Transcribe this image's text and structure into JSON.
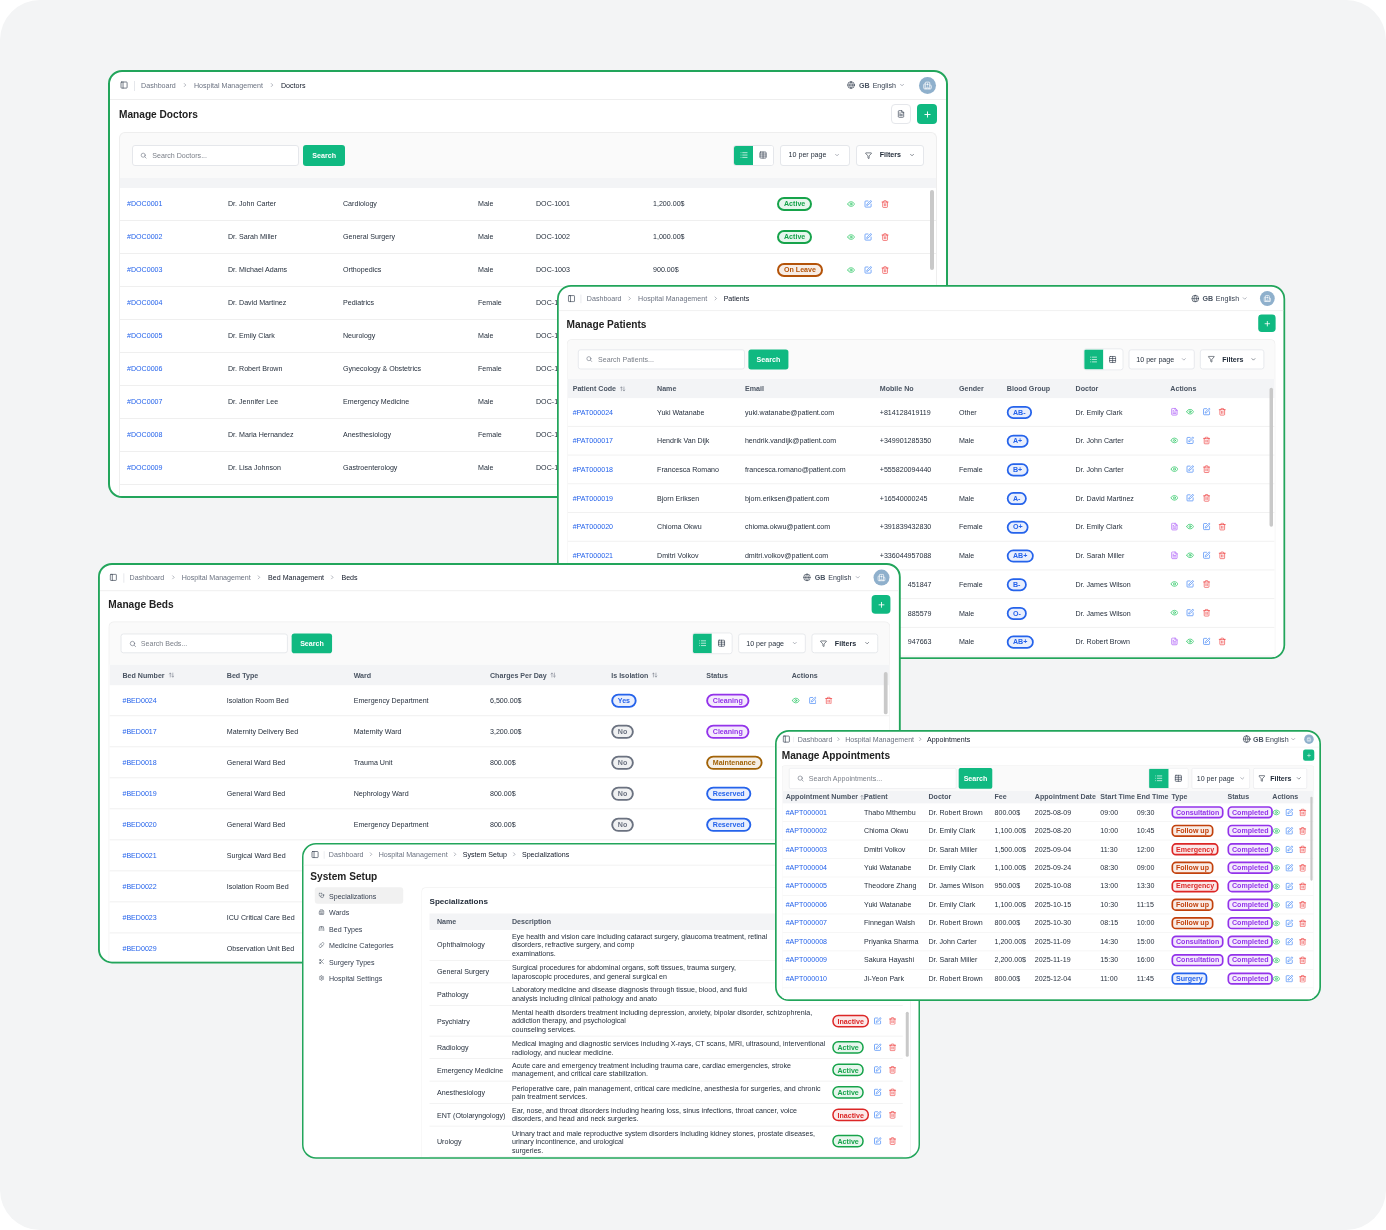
{
  "windows": [
    {
      "kind": "table",
      "breadcrumb": [
        {
          "label": "Dashboard",
          "muted": true
        },
        {
          "label": "Hospital Management",
          "muted": true
        },
        {
          "label": "Doctors",
          "muted": false
        }
      ],
      "language": {
        "code": "GB",
        "label": "English"
      },
      "title": "Manage Doctors",
      "export_button": true,
      "add_button": true,
      "search": {
        "placeholder": "Search Doctors...",
        "button": "Search"
      },
      "view_toggle": [
        {
          "selected": true
        },
        {
          "selected": false
        }
      ],
      "per_page": "10 per page",
      "filters": "Filters",
      "rows": [
        [
          {
            "link": "#DOC0001"
          },
          "Dr. John Carter",
          "Cardiology",
          "Male",
          "DOC-1001",
          "1,200.00$",
          {
            "badge": "Active",
            "color": "#16a34a"
          },
          {
            "actions": [
              {
                "kind": "view"
              },
              {
                "kind": "edit"
              },
              {
                "kind": "delete"
              }
            ]
          }
        ],
        [
          {
            "link": "#DOC0002"
          },
          "Dr. Sarah Miller",
          "General Surgery",
          "Male",
          "DOC-1002",
          "1,000.00$",
          {
            "badge": "Active",
            "color": "#16a34a"
          },
          {
            "actions": [
              {
                "kind": "view"
              },
              {
                "kind": "edit"
              },
              {
                "kind": "delete"
              }
            ]
          }
        ],
        [
          {
            "link": "#DOC0003"
          },
          "Dr. Michael Adams",
          "Orthopedics",
          "Male",
          "DOC-1003",
          "900.00$",
          {
            "badge": "On Leave",
            "color": "#b45309"
          },
          {
            "actions": [
              {
                "kind": "view"
              },
              {
                "kind": "edit"
              },
              {
                "kind": "delete"
              }
            ]
          }
        ],
        [
          {
            "link": "#DOC0004"
          },
          "Dr. David Martinez",
          "Pediatrics",
          "Female",
          "DOC-1"
        ],
        [
          {
            "link": "#DOC0005"
          },
          "Dr. Emily Clark",
          "Neurology",
          "Male",
          "DOC-1"
        ],
        [
          {
            "link": "#DOC0006"
          },
          "Dr. Robert Brown",
          "Gynecology & Obstetrics",
          "Female",
          "DOC-1"
        ],
        [
          {
            "link": "#DOC0007"
          },
          "Dr. Jennifer Lee",
          "Emergency Medicine",
          "Male",
          "DOC-1"
        ],
        [
          {
            "link": "#DOC0008"
          },
          "Dr. Maria Hernandez",
          "Anesthesiology",
          "Female",
          "DOC-1"
        ],
        [
          {
            "link": "#DOC0009"
          },
          "Dr. Lisa Johnson",
          "Gastroenterology",
          "Male",
          "DOC-1"
        ]
      ]
    },
    {
      "kind": "table",
      "breadcrumb": [
        {
          "label": "Dashboard",
          "muted": true
        },
        {
          "label": "Hospital Management",
          "muted": true
        },
        {
          "label": "Patients",
          "muted": false
        }
      ],
      "language": {
        "code": "GB",
        "label": "English"
      },
      "title": "Manage Patients",
      "add_button": true,
      "search": {
        "placeholder": "Search Patients...",
        "button": "Search"
      },
      "view_toggle": [
        {
          "selected": true
        },
        {
          "selected": false
        }
      ],
      "per_page": "10 per page",
      "filters": "Filters",
      "columns": [
        {
          "label": "Patient Code",
          "sortable": true
        },
        {
          "label": "Name",
          "sortable": false
        },
        {
          "label": "Email",
          "sortable": false
        },
        {
          "label": "Mobile No",
          "sortable": false
        },
        {
          "label": "Gender",
          "sortable": false
        },
        {
          "label": "Blood Group",
          "sortable": false
        },
        {
          "label": "Doctor",
          "sortable": false
        },
        {
          "label": "Actions",
          "sortable": false
        }
      ],
      "rows": [
        [
          {
            "link": "#PAT000024"
          },
          "Yuki Watanabe",
          "yuki.watanabe@patient.com",
          "+814128419119",
          "Other",
          {
            "badge": "AB-",
            "color": "#2563eb"
          },
          "Dr. Emily Clark",
          {
            "actions": [
              {
                "kind": "report"
              },
              {
                "kind": "view"
              },
              {
                "kind": "edit"
              },
              {
                "kind": "delete"
              }
            ]
          }
        ],
        [
          {
            "link": "#PAT000017"
          },
          "Hendrik Van Dijk",
          "hendrik.vandijk@patient.com",
          "+349901285350",
          "Male",
          {
            "badge": "A+",
            "color": "#2563eb"
          },
          "Dr. John Carter",
          {
            "actions": [
              {
                "kind": "view"
              },
              {
                "kind": "edit"
              },
              {
                "kind": "delete"
              }
            ]
          }
        ],
        [
          {
            "link": "#PAT000018"
          },
          "Francesca Romano",
          "francesca.romano@patient.com",
          "+555820094440",
          "Female",
          {
            "badge": "B+",
            "color": "#2563eb"
          },
          "Dr. John Carter",
          {
            "actions": [
              {
                "kind": "view"
              },
              {
                "kind": "edit"
              },
              {
                "kind": "delete"
              }
            ]
          }
        ],
        [
          {
            "link": "#PAT000019"
          },
          "Bjorn Eriksen",
          "bjorn.eriksen@patient.com",
          "+16540000245",
          "Male",
          {
            "badge": "A-",
            "color": "#2563eb"
          },
          "Dr. David Martinez",
          {
            "actions": [
              {
                "kind": "view"
              },
              {
                "kind": "edit"
              },
              {
                "kind": "delete"
              }
            ]
          }
        ],
        [
          {
            "link": "#PAT000020"
          },
          "Chioma Okwu",
          "chioma.okwu@patient.com",
          "+391839432830",
          "Female",
          {
            "badge": "O+",
            "color": "#2563eb"
          },
          "Dr. Emily Clark",
          {
            "actions": [
              {
                "kind": "report"
              },
              {
                "kind": "view"
              },
              {
                "kind": "edit"
              },
              {
                "kind": "delete"
              }
            ]
          }
        ],
        [
          {
            "link": "#PAT000021"
          },
          "Dmitri Volkov",
          "dmitri.volkov@patient.com",
          "+336044957088",
          "Male",
          {
            "badge": "AB+",
            "color": "#2563eb"
          },
          "Dr. Sarah Miller",
          {
            "actions": [
              {
                "kind": "report"
              },
              {
                "kind": "view"
              },
              {
                "kind": "edit"
              },
              {
                "kind": "delete"
              }
            ]
          }
        ],
        [
          null,
          null,
          null,
          {
            "text": "451847",
            "cut": true
          },
          "Female",
          {
            "badge": "B-",
            "color": "#2563eb"
          },
          "Dr. James Wilson",
          {
            "actions": [
              {
                "kind": "view"
              },
              {
                "kind": "edit"
              },
              {
                "kind": "delete"
              }
            ]
          }
        ],
        [
          null,
          null,
          null,
          {
            "text": "885579",
            "cut": true
          },
          "Male",
          {
            "badge": "O-",
            "color": "#2563eb"
          },
          "Dr. James Wilson",
          {
            "actions": [
              {
                "kind": "view"
              },
              {
                "kind": "edit"
              },
              {
                "kind": "delete"
              }
            ]
          }
        ],
        [
          null,
          null,
          null,
          {
            "text": "947663",
            "cut": true
          },
          "Male",
          {
            "badge": "AB+",
            "color": "#2563eb"
          },
          "Dr. Robert Brown",
          {
            "actions": [
              {
                "kind": "report"
              },
              {
                "kind": "view"
              },
              {
                "kind": "edit"
              },
              {
                "kind": "delete"
              }
            ]
          }
        ]
      ]
    },
    {
      "kind": "table",
      "breadcrumb": [
        {
          "label": "Dashboard",
          "muted": true
        },
        {
          "label": "Hospital Management",
          "muted": true
        },
        {
          "label": "Bed Management",
          "muted": false
        },
        {
          "label": "Beds",
          "muted": false
        }
      ],
      "language": {
        "code": "GB",
        "label": "English"
      },
      "title": "Manage Beds",
      "add_button": true,
      "search": {
        "placeholder": "Search Beds...",
        "button": "Search"
      },
      "view_toggle": [
        {
          "selected": true
        },
        {
          "selected": false
        }
      ],
      "per_page": "10 per page",
      "filters": "Filters",
      "columns": [
        {
          "label": "Bed Number",
          "sortable": true
        },
        {
          "label": "Bed Type",
          "sortable": false
        },
        {
          "label": "Ward",
          "sortable": false
        },
        {
          "label": "Charges Per Day",
          "sortable": true
        },
        {
          "label": "Is Isolation",
          "sortable": true
        },
        {
          "label": "Status",
          "sortable": false
        },
        {
          "label": "Actions",
          "sortable": false
        }
      ],
      "rows": [
        [
          {
            "link": "#BED0024"
          },
          "Isolation Room Bed",
          "Emergency Department",
          "6,500.00$",
          {
            "badge": "Yes",
            "color": "#2563eb"
          },
          {
            "badge": "Cleaning",
            "color": "#9333ea"
          },
          {
            "actions": [
              {
                "kind": "view"
              },
              {
                "kind": "edit"
              },
              {
                "kind": "delete"
              }
            ]
          }
        ],
        [
          {
            "link": "#BED0017"
          },
          "Maternity Delivery Bed",
          "Maternity Ward",
          "3,200.00$",
          {
            "badge": "No",
            "color": "#6b7280"
          },
          {
            "badge": "Cleaning",
            "color": "#9333ea"
          }
        ],
        [
          {
            "link": "#BED0018"
          },
          "General Ward Bed",
          "Trauma Unit",
          "800.00$",
          {
            "badge": "No",
            "color": "#6b7280"
          },
          {
            "badge": "Maintenance",
            "color": "#a16207"
          }
        ],
        [
          {
            "link": "#BED0019"
          },
          "General Ward Bed",
          "Nephrology Ward",
          "800.00$",
          {
            "badge": "No",
            "color": "#6b7280"
          },
          {
            "badge": "Reserved",
            "color": "#2563eb"
          }
        ],
        [
          {
            "link": "#BED0020"
          },
          "General Ward Bed",
          "Emergency Department",
          "800.00$",
          {
            "badge": "No",
            "color": "#6b7280"
          },
          {
            "badge": "Reserved",
            "color": "#2563eb"
          }
        ],
        [
          {
            "link": "#BED0021"
          },
          "Surgical Ward Bed"
        ],
        [
          {
            "link": "#BED0022"
          },
          "Isolation Room Bed"
        ],
        [
          {
            "link": "#BED0023"
          },
          "ICU Critical Care Bed"
        ],
        [
          {
            "link": "#BED0029"
          },
          "Observation Unit Bed"
        ]
      ]
    },
    {
      "kind": "setup",
      "breadcrumb": [
        {
          "label": "Dashboard",
          "muted": true
        },
        {
          "label": "Hospital Management",
          "muted": true
        },
        {
          "label": "System Setup",
          "muted": false
        },
        {
          "label": "Specializations",
          "muted": false
        }
      ],
      "title": "System Setup",
      "sidebar": [
        {
          "label": "Specializations",
          "kind": "specialty",
          "selected": true
        },
        {
          "label": "Wards",
          "kind": "wards",
          "selected": false
        },
        {
          "label": "Bed Types",
          "kind": "bed",
          "selected": false
        },
        {
          "label": "Medicine Categories",
          "kind": "medicine",
          "selected": false
        },
        {
          "label": "Surgery Types",
          "kind": "surgery",
          "selected": false
        },
        {
          "label": "Hospital Settings",
          "kind": "settings",
          "selected": false
        }
      ],
      "section_title": "Specializations",
      "columns": [
        {
          "label": "Name"
        },
        {
          "label": "Description"
        }
      ],
      "rows": [
        {
          "name": "Ophthalmology",
          "description": [
            "Eye health and vision care including cataract surgery, glaucoma treatment, retinal disorders, refractive surgery, and comp",
            "examinations."
          ]
        },
        {
          "name": "General Surgery",
          "description": [
            "Surgical procedures for abdominal organs, soft tissues, trauma surgery, laparoscopic procedures, and general surgical en"
          ]
        },
        {
          "name": "Pathology",
          "description": [
            "Laboratory medicine and disease diagnosis through tissue, blood, and fluid analysis including clinical pathology and anato"
          ]
        },
        {
          "name": "Psychiatry",
          "description": [
            "Mental health disorders treatment including depression, anxiety, bipolar disorder, schizophrenia, addiction therapy, and psychological",
            "counseling services."
          ],
          "status": {
            "badge": "Inactive",
            "color": "#dc2626"
          },
          "actions": [
            {
              "kind": "edit"
            },
            {
              "kind": "delete"
            }
          ]
        },
        {
          "name": "Radiology",
          "description": [
            "Medical imaging and diagnostic services including X-rays, CT scans, MRI, ultrasound, interventional radiology, and nuclear medicine."
          ],
          "status": {
            "badge": "Active",
            "color": "#16a34a"
          },
          "actions": [
            {
              "kind": "edit"
            },
            {
              "kind": "delete"
            }
          ]
        },
        {
          "name": "Emergency Medicine",
          "description": [
            "Acute care and emergency treatment including trauma care, cardiac emergencies, stroke management, and critical care stabilization."
          ],
          "status": {
            "badge": "Active",
            "color": "#16a34a"
          },
          "actions": [
            {
              "kind": "edit"
            },
            {
              "kind": "delete"
            }
          ]
        },
        {
          "name": "Anesthesiology",
          "description": [
            "Perioperative care, pain management, critical care medicine, anesthesia for surgeries, and chronic pain treatment services."
          ],
          "status": {
            "badge": "Active",
            "color": "#16a34a"
          },
          "actions": [
            {
              "kind": "edit"
            },
            {
              "kind": "delete"
            }
          ]
        },
        {
          "name": "ENT (Otolaryngology)",
          "description": [
            "Ear, nose, and throat disorders including hearing loss, sinus infections, throat cancer, voice disorders, and head and neck surgeries."
          ],
          "status": {
            "badge": "Inactive",
            "color": "#dc2626"
          },
          "actions": [
            {
              "kind": "edit"
            },
            {
              "kind": "delete"
            }
          ]
        },
        {
          "name": "Urology",
          "description": [
            "Urinary tract and male reproductive system disorders including kidney stones, prostate diseases, urinary incontinence, and urological",
            "surgeries."
          ],
          "status": {
            "badge": "Active",
            "color": "#16a34a"
          },
          "actions": [
            {
              "kind": "edit"
            },
            {
              "kind": "delete"
            }
          ]
        }
      ]
    },
    {
      "kind": "table",
      "breadcrumb": [
        {
          "label": "Dashboard",
          "muted": true
        },
        {
          "label": "Hospital Management",
          "muted": true
        },
        {
          "label": "Appointments",
          "muted": false
        }
      ],
      "language": {
        "code": "GB",
        "label": "English"
      },
      "title": "Manage Appointments",
      "add_button": true,
      "search": {
        "placeholder": "Search Appointments...",
        "button": "Search"
      },
      "view_toggle": [
        {
          "selected": true
        },
        {
          "selected": false
        }
      ],
      "per_page": "10 per page",
      "filters": "Filters",
      "columns": [
        {
          "label": "Appointment Number",
          "sortable": true
        },
        {
          "label": "Patient",
          "sortable": false
        },
        {
          "label": "Doctor",
          "sortable": false
        },
        {
          "label": "Fee",
          "sortable": false
        },
        {
          "label": "Appointment Date",
          "sortable": false
        },
        {
          "label": "Start Time",
          "sortable": false
        },
        {
          "label": "End Time",
          "sortable": false
        },
        {
          "label": "Type",
          "sortable": false
        },
        {
          "label": "Status",
          "sortable": false
        },
        {
          "label": "Actions",
          "sortable": false
        }
      ],
      "rows": [
        [
          {
            "link": "#APT000001"
          },
          "Thabo Mthembu",
          "Dr. Robert Brown",
          "800.00$",
          "2025-08-09",
          "09:00",
          "09:30",
          {
            "badge": "Consultation",
            "color": "#9333ea"
          },
          {
            "badge": "Completed",
            "color": "#9333ea"
          },
          {
            "actions": [
              {
                "kind": "view"
              },
              {
                "kind": "edit"
              },
              {
                "kind": "delete"
              }
            ]
          }
        ],
        [
          {
            "link": "#APT000002"
          },
          "Chioma Okwu",
          "Dr. Emily Clark",
          "1,100.00$",
          "2025-08-20",
          "10:00",
          "10:45",
          {
            "badge": "Follow up",
            "color": "#c2410c"
          },
          {
            "badge": "Completed",
            "color": "#9333ea"
          },
          {
            "actions": [
              {
                "kind": "view"
              },
              {
                "kind": "edit"
              },
              {
                "kind": "delete"
              }
            ]
          }
        ],
        [
          {
            "link": "#APT000003"
          },
          "Dmitri Volkov",
          "Dr. Sarah Miller",
          "1,500.00$",
          "2025-09-04",
          "11:30",
          "12:00",
          {
            "badge": "Emergency",
            "color": "#dc2626"
          },
          {
            "badge": "Completed",
            "color": "#9333ea"
          },
          {
            "actions": [
              {
                "kind": "view"
              },
              {
                "kind": "edit"
              },
              {
                "kind": "delete"
              }
            ]
          }
        ],
        [
          {
            "link": "#APT000004"
          },
          "Yuki Watanabe",
          "Dr. Emily Clark",
          "1,100.00$",
          "2025-09-24",
          "08:30",
          "09:00",
          {
            "badge": "Follow up",
            "color": "#c2410c"
          },
          {
            "badge": "Completed",
            "color": "#9333ea"
          },
          {
            "actions": [
              {
                "kind": "view"
              },
              {
                "kind": "edit"
              },
              {
                "kind": "delete"
              }
            ]
          }
        ],
        [
          {
            "link": "#APT000005"
          },
          "Theodore Zhang",
          "Dr. James Wilson",
          "950.00$",
          "2025-10-08",
          "13:00",
          "13:30",
          {
            "badge": "Emergency",
            "color": "#dc2626"
          },
          {
            "badge": "Completed",
            "color": "#9333ea"
          },
          {
            "actions": [
              {
                "kind": "view"
              },
              {
                "kind": "edit"
              },
              {
                "kind": "delete"
              }
            ]
          }
        ],
        [
          {
            "link": "#APT000006"
          },
          "Yuki Watanabe",
          "Dr. Emily Clark",
          "1,100.00$",
          "2025-10-15",
          "10:30",
          "11:15",
          {
            "badge": "Follow up",
            "color": "#c2410c"
          },
          {
            "badge": "Completed",
            "color": "#9333ea"
          },
          {
            "actions": [
              {
                "kind": "view"
              },
              {
                "kind": "edit"
              },
              {
                "kind": "delete"
              }
            ]
          }
        ],
        [
          {
            "link": "#APT000007"
          },
          "Finnegan Walsh",
          "Dr. Robert Brown",
          "800.00$",
          "2025-10-30",
          "08:15",
          "10:00",
          {
            "badge": "Follow up",
            "color": "#c2410c"
          },
          {
            "badge": "Completed",
            "color": "#9333ea"
          },
          {
            "actions": [
              {
                "kind": "view"
              },
              {
                "kind": "edit"
              },
              {
                "kind": "delete"
              }
            ]
          }
        ],
        [
          {
            "link": "#APT000008"
          },
          "Priyanka Sharma",
          "Dr. John Carter",
          "1,200.00$",
          "2025-11-09",
          "14:30",
          "15:00",
          {
            "badge": "Consultation",
            "color": "#9333ea"
          },
          {
            "badge": "Completed",
            "color": "#9333ea"
          },
          {
            "actions": [
              {
                "kind": "view"
              },
              {
                "kind": "edit"
              },
              {
                "kind": "delete"
              }
            ]
          }
        ],
        [
          {
            "link": "#APT000009"
          },
          "Sakura Hayashi",
          "Dr. Sarah Miller",
          "2,200.00$",
          "2025-11-19",
          "15:30",
          "16:00",
          {
            "badge": "Consultation",
            "color": "#9333ea"
          },
          {
            "badge": "Completed",
            "color": "#9333ea"
          },
          {
            "actions": [
              {
                "kind": "view"
              },
              {
                "kind": "edit"
              },
              {
                "kind": "delete"
              }
            ]
          }
        ],
        [
          {
            "link": "#APT000010"
          },
          "Ji-Yeon Park",
          "Dr. Robert Brown",
          "800.00$",
          "2025-12-04",
          "11:00",
          "11:45",
          {
            "badge": "Surgery",
            "color": "#2563eb"
          },
          {
            "badge": "Completed",
            "color": "#9333ea"
          },
          {
            "actions": [
              {
                "kind": "view"
              },
              {
                "kind": "edit"
              },
              {
                "kind": "delete"
              }
            ]
          }
        ]
      ]
    }
  ]
}
